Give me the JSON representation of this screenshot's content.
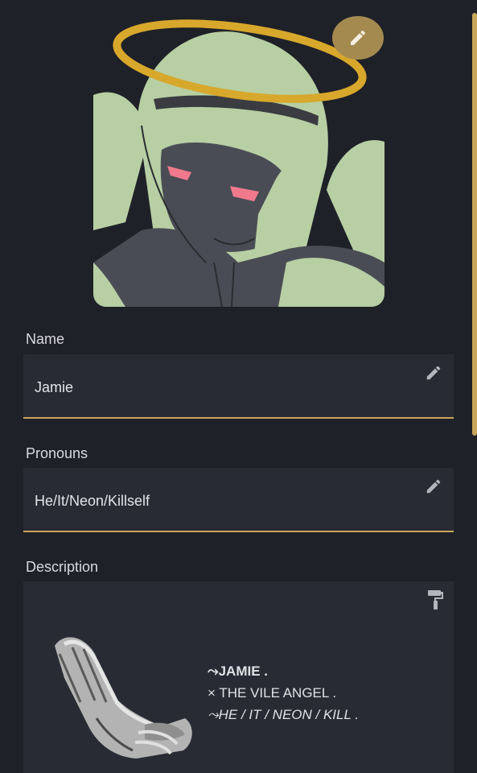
{
  "profile": {
    "avatar_alt": "Avatar: green-haired angel character with halo",
    "name_label": "Name",
    "name_value": "Jamie",
    "pronouns_label": "Pronouns",
    "pronouns_value": "He/It/Neon/Killself",
    "description_label": "Description",
    "description_lines": [
      "⤳JAMIE .",
      "× THE VILE ANGEL .",
      "⤳HE / IT / NEON / KILL ."
    ]
  },
  "icons": {
    "edit_avatar": "pencil-icon",
    "edit_name": "pencil-icon",
    "edit_pronouns": "pencil-icon",
    "description_style": "paint-roller-icon"
  },
  "colors": {
    "background": "#1f2128",
    "field_background": "#292b34",
    "accent": "#c9a55a",
    "edit_button": "#a58a50",
    "avatar_green": "#b7cfa3"
  }
}
